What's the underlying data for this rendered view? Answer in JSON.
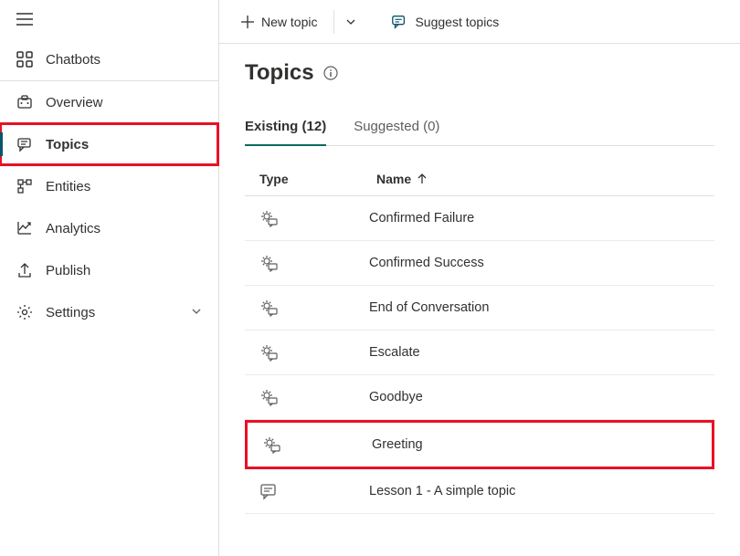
{
  "sidebar": {
    "chatbots_label": "Chatbots",
    "items": [
      {
        "id": "overview",
        "label": "Overview",
        "selected": false,
        "hasChevron": false
      },
      {
        "id": "topics",
        "label": "Topics",
        "selected": true,
        "hasChevron": false
      },
      {
        "id": "entities",
        "label": "Entities",
        "selected": false,
        "hasChevron": false
      },
      {
        "id": "analytics",
        "label": "Analytics",
        "selected": false,
        "hasChevron": false
      },
      {
        "id": "publish",
        "label": "Publish",
        "selected": false,
        "hasChevron": false
      },
      {
        "id": "settings",
        "label": "Settings",
        "selected": false,
        "hasChevron": true
      }
    ]
  },
  "toolbar": {
    "new_topic_label": "New topic",
    "suggest_topics_label": "Suggest topics"
  },
  "page": {
    "title": "Topics"
  },
  "tabs": [
    {
      "id": "existing",
      "label": "Existing (12)",
      "active": true
    },
    {
      "id": "suggested",
      "label": "Suggested (0)",
      "active": false
    }
  ],
  "table": {
    "headers": {
      "type": "Type",
      "name": "Name"
    },
    "sort_direction": "asc",
    "rows": [
      {
        "icon": "system",
        "name": "Confirmed Failure",
        "highlighted": false
      },
      {
        "icon": "system",
        "name": "Confirmed Success",
        "highlighted": false
      },
      {
        "icon": "system",
        "name": "End of Conversation",
        "highlighted": false
      },
      {
        "icon": "system",
        "name": "Escalate",
        "highlighted": false
      },
      {
        "icon": "system",
        "name": "Goodbye",
        "highlighted": false
      },
      {
        "icon": "system",
        "name": "Greeting",
        "highlighted": true
      },
      {
        "icon": "user",
        "name": "Lesson 1 - A simple topic",
        "highlighted": false
      }
    ]
  },
  "highlights": {
    "sidebar_item": "topics",
    "row_name": "Greeting"
  }
}
